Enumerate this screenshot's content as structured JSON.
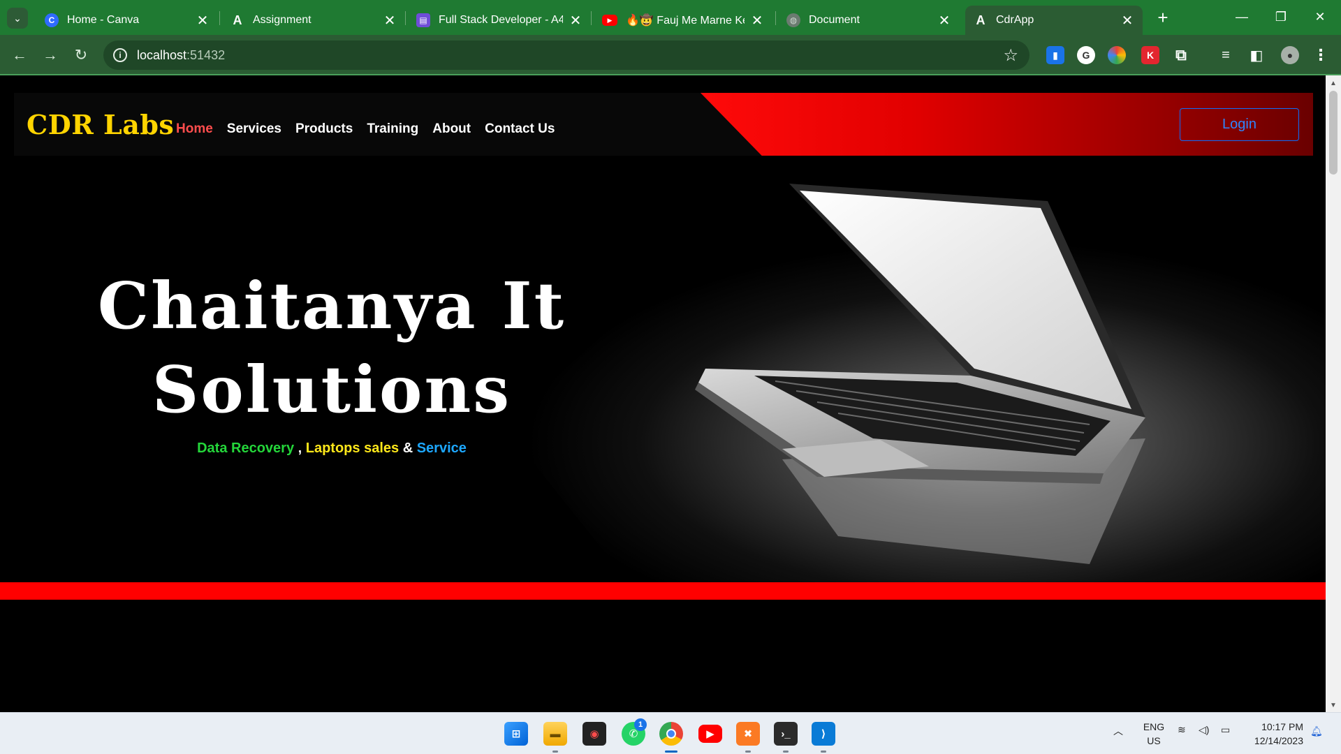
{
  "browser": {
    "tabs": [
      {
        "title": "Home - Canva",
        "icon": "canva-icon",
        "color": "#2f6bff",
        "glyph": "C"
      },
      {
        "title": "Assignment",
        "icon": "angular-icon",
        "color": "#1c1c1c",
        "glyph": "A"
      },
      {
        "title": "Full Stack Developer - A4",
        "icon": "document-icon",
        "color": "#6f4dd8",
        "glyph": "▤"
      },
      {
        "title": "🔥🤠 Fauj Me Marne Keliy",
        "icon": "youtube-icon",
        "color": "#ff0000",
        "glyph": "▶"
      },
      {
        "title": "Document",
        "icon": "globe-icon",
        "color": "#6b7b70",
        "glyph": "◍"
      },
      {
        "title": "CdrApp",
        "icon": "angular-icon",
        "color": "#1c1c1c",
        "glyph": "A"
      }
    ],
    "active_tab": 5,
    "close_glyph": "✕",
    "new_tab_glyph": "+",
    "address": {
      "host": "localhost",
      "port": ":51432"
    }
  },
  "site": {
    "brand": "CDR Labs",
    "nav": [
      "Home",
      "Services",
      "Products",
      "Training",
      "About",
      "Contact Us"
    ],
    "active_nav": "Home",
    "login_label": "Login",
    "hero": {
      "title_line1": "Chaitanya It",
      "title_line2": "Solutions",
      "sub_data_recovery": "Data Recovery",
      "sub_sep1": " , ",
      "sub_laptops": "Laptops sales",
      "sub_sep2": " & ",
      "sub_service": "Service"
    },
    "colors": {
      "brand": "#ffd400",
      "accent_red": "#ff0000",
      "login_blue": "#0d6efd"
    }
  },
  "taskbar": {
    "apps": [
      "start-icon",
      "file-explorer-icon",
      "screen-recorder-icon",
      "whatsapp-icon",
      "chrome-icon",
      "youtube-icon",
      "xampp-icon",
      "terminal-icon",
      "vscode-icon"
    ],
    "whatsapp_badge": "1",
    "lang_line1": "ENG",
    "lang_line2": "US",
    "time": "10:17 PM",
    "date": "12/14/2023"
  }
}
